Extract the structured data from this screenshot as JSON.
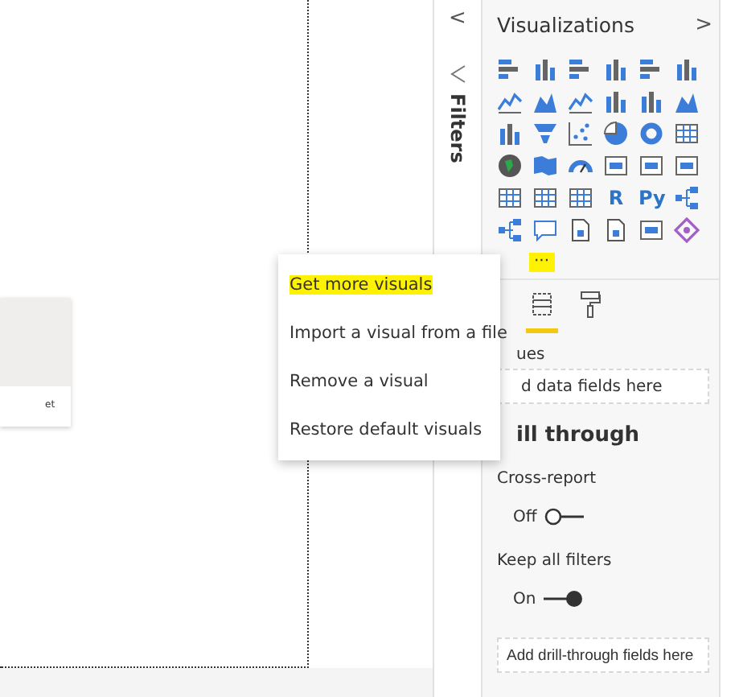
{
  "canvas": {
    "card_caption": "et"
  },
  "filters_pane": {
    "collapse_glyph": "<",
    "title": "Filters"
  },
  "visualizations": {
    "title": "Visualizations",
    "expand_glyph": ">",
    "icons": [
      {
        "kind": "hbar"
      },
      {
        "kind": "vbar"
      },
      {
        "kind": "hbar"
      },
      {
        "kind": "vbar"
      },
      {
        "kind": "hbar"
      },
      {
        "kind": "vbar"
      },
      {
        "kind": "line"
      },
      {
        "kind": "area"
      },
      {
        "kind": "line"
      },
      {
        "kind": "vbar"
      },
      {
        "kind": "vbar"
      },
      {
        "kind": "area"
      },
      {
        "kind": "vbar"
      },
      {
        "kind": "funnel"
      },
      {
        "kind": "scatter"
      },
      {
        "kind": "pie"
      },
      {
        "kind": "donut"
      },
      {
        "kind": "grid"
      },
      {
        "kind": "globe"
      },
      {
        "kind": "map"
      },
      {
        "kind": "gauge"
      },
      {
        "kind": "card"
      },
      {
        "kind": "card"
      },
      {
        "kind": "card"
      },
      {
        "kind": "grid"
      },
      {
        "kind": "grid"
      },
      {
        "kind": "grid"
      },
      {
        "kind": "glyph",
        "label": "R"
      },
      {
        "kind": "glyph",
        "label": "Py"
      },
      {
        "kind": "tree"
      },
      {
        "kind": "tree"
      },
      {
        "kind": "speech"
      },
      {
        "kind": "doc"
      },
      {
        "kind": "doc"
      },
      {
        "kind": "card"
      },
      {
        "kind": "diamond"
      }
    ],
    "more_button": {
      "label": "···",
      "highlighted": true
    },
    "pane_tabs": [
      {
        "kind": "fields",
        "selected": true
      },
      {
        "kind": "format",
        "selected": false
      }
    ],
    "values_label": "ues",
    "values_field": {
      "placeholder": "d data fields here"
    },
    "drill_heading": "ill through",
    "toggles": [
      {
        "label": "Cross-report",
        "state_text": "Off",
        "on": false
      },
      {
        "label": "Keep all filters",
        "state_text": "On",
        "on": true
      }
    ],
    "drill_field": {
      "placeholder": "Add drill-through fields here"
    }
  },
  "context_menu": [
    {
      "label": "Get more visuals",
      "highlighted": true
    },
    {
      "label": "Import a visual from a file",
      "highlighted": false
    },
    {
      "label": "Remove a visual",
      "highlighted": false
    },
    {
      "label": "Restore default visuals",
      "highlighted": false
    }
  ]
}
